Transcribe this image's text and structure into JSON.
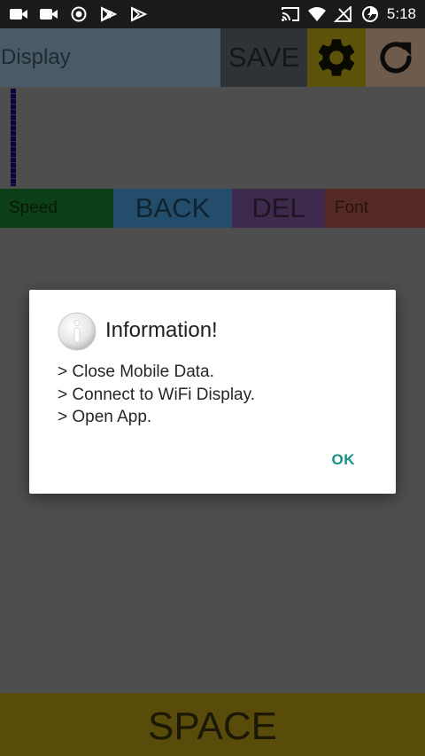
{
  "status_bar": {
    "time": "5:18",
    "left_icons": [
      "video-icon",
      "video-icon",
      "record-icon",
      "play-store-icon",
      "play-store-icon"
    ],
    "right_icons": [
      "cast-icon",
      "wifi-icon",
      "signal-icon",
      "data-saver-icon"
    ]
  },
  "toolbar": {
    "display_label": "Display",
    "save_label": "SAVE",
    "settings_icon": "gear-icon",
    "refresh_icon": "refresh-icon",
    "colors": {
      "display": "#4a5a66",
      "save": "#2e3338",
      "settings": "#5c520a",
      "refresh": "#6f5b4c"
    }
  },
  "controls": {
    "speed_label": "Speed",
    "back_label": "BACK",
    "del_label": "DEL",
    "font_label": "Font",
    "colors": {
      "speed": "#0c3f17",
      "back": "#234d6a",
      "del": "#3d2a4d",
      "font": "#562a24"
    }
  },
  "space_bar": {
    "label": "SPACE",
    "color": "#594c0b"
  },
  "dialog": {
    "icon": "info-icon",
    "title": "Information!",
    "lines": [
      "> Close Mobile Data.",
      "> Connect to WiFi Display.",
      "> Open App."
    ],
    "ok_label": "OK",
    "ok_color": "#1a8f89"
  }
}
